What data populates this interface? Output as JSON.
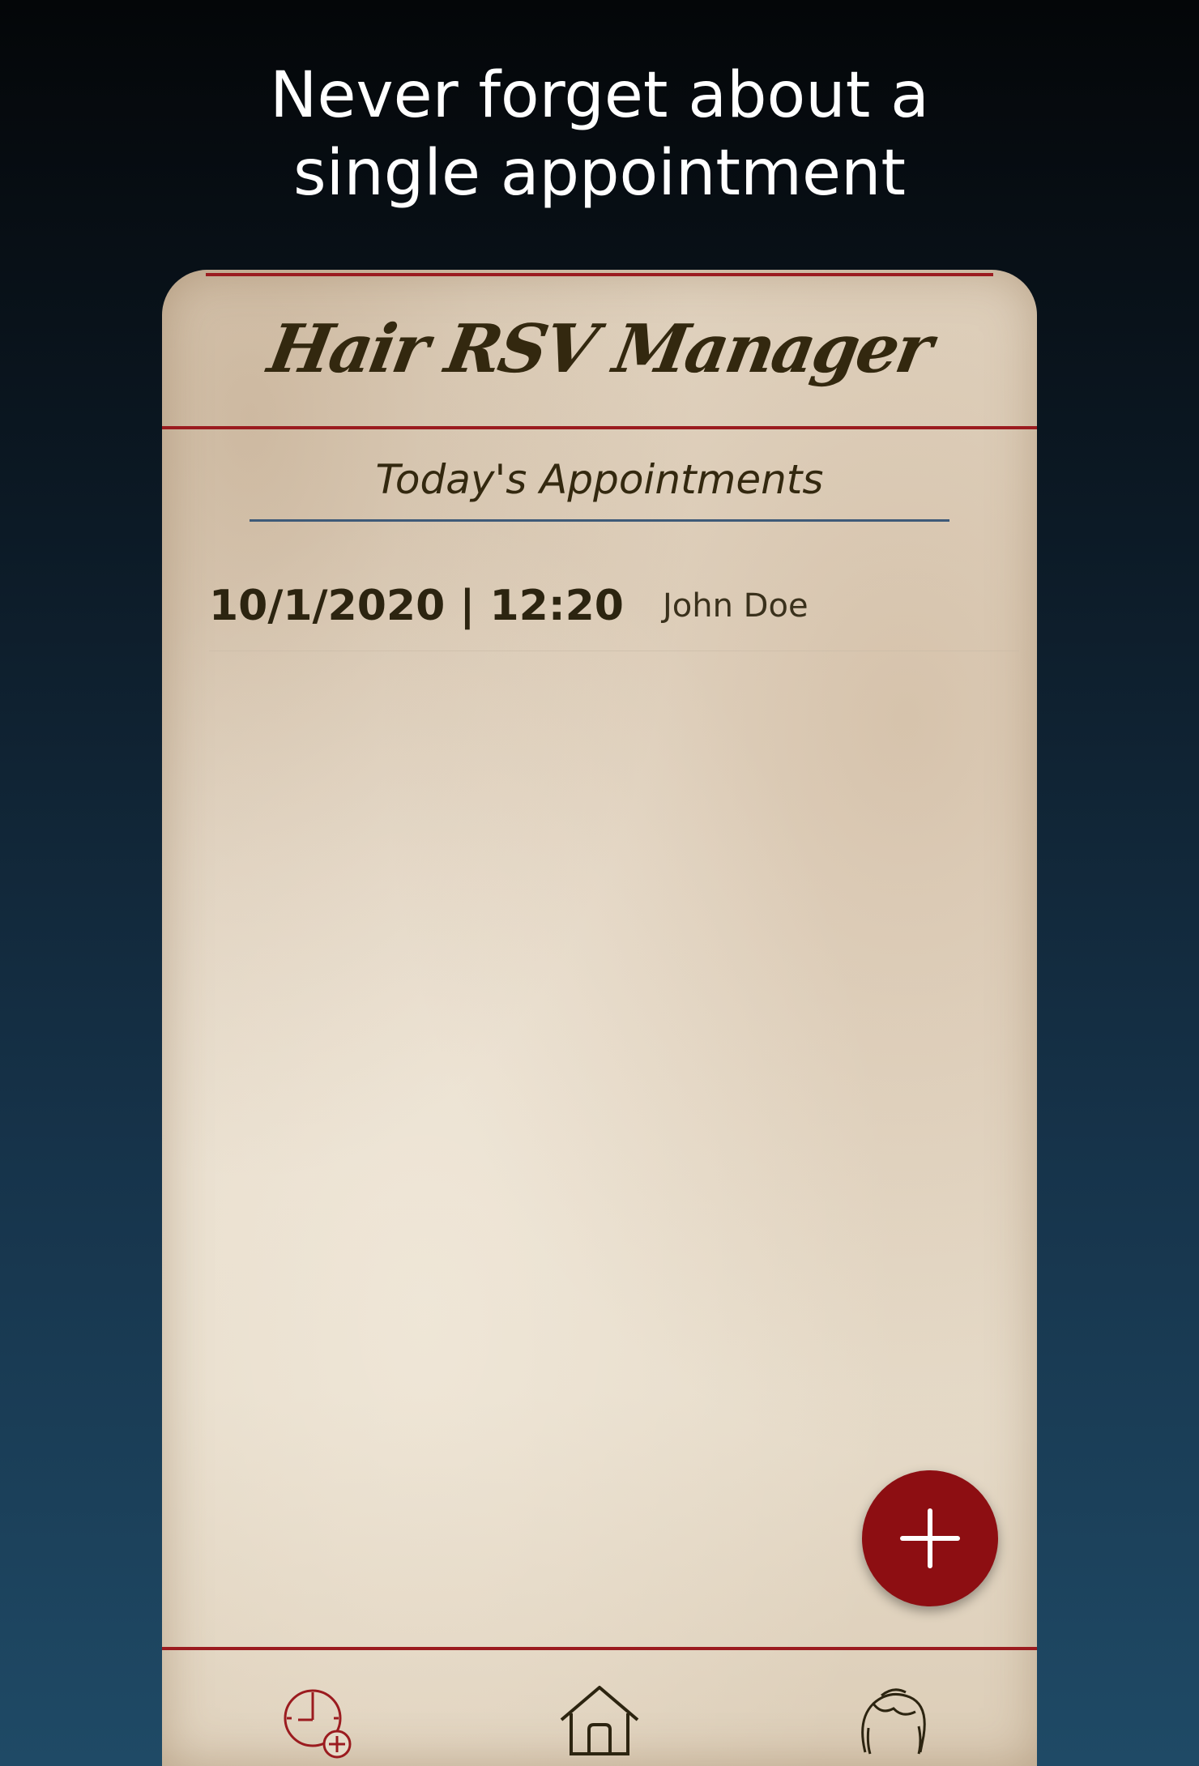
{
  "promo": {
    "headline_line1": "Never forget about a",
    "headline_line2": "single appointment"
  },
  "app": {
    "title": "Hair RSV Manager"
  },
  "section": {
    "title": "Today's Appointments"
  },
  "appointments": [
    {
      "datetime": "10/1/2020 | 12:20",
      "name": "John Doe"
    }
  ],
  "fab": {
    "icon": "plus-icon"
  },
  "bottom_nav": {
    "items": [
      {
        "icon": "clock-add-icon"
      },
      {
        "icon": "home-icon"
      },
      {
        "icon": "hair-icon"
      }
    ]
  },
  "colors": {
    "accent_red": "#9b1b1f",
    "fab_red": "#8d0e12",
    "text_dark": "#33280f",
    "underline_blue": "#3e5a78"
  }
}
